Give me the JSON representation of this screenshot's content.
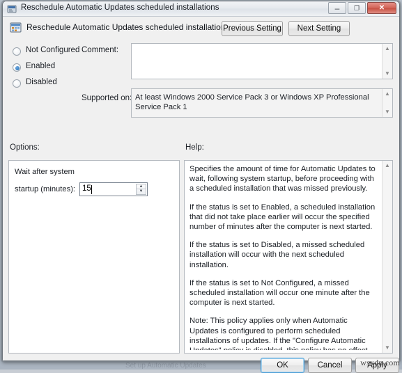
{
  "window": {
    "title": "Reschedule Automatic Updates scheduled installations",
    "title_icon": "policy-setting-icon",
    "minimize_glyph": "–",
    "maximize_glyph": "❐",
    "close_glyph": "✕"
  },
  "header": {
    "icon": "calendar-setting-icon",
    "title": "Reschedule Automatic Updates scheduled installations",
    "previous_button": "Previous Setting",
    "next_button": "Next Setting"
  },
  "state": {
    "options": [
      {
        "label": "Not Configured",
        "selected": false
      },
      {
        "label": "Enabled",
        "selected": true
      },
      {
        "label": "Disabled",
        "selected": false
      }
    ]
  },
  "comment": {
    "label": "Comment:",
    "value": "",
    "scroll_up": "▲",
    "scroll_down": "▼"
  },
  "supported": {
    "label": "Supported on:",
    "value": "At least Windows 2000 Service Pack 3 or Windows XP Professional Service Pack 1",
    "scroll_up": "▲",
    "scroll_down": "▼"
  },
  "options_panel": {
    "label": "Options:",
    "field_label_line1": "Wait after system",
    "field_label_line2": "startup (minutes):",
    "value": "15",
    "spin_up": "▲",
    "spin_down": "▼"
  },
  "help_panel": {
    "label": "Help:",
    "scroll_up": "▲",
    "scroll_down": "▼",
    "paragraphs": [
      "Specifies the amount of time for Automatic Updates to wait, following system startup, before proceeding with a scheduled installation that was missed previously.",
      "If the status is set to Enabled, a scheduled installation that did not take place earlier will occur the specified number of minutes after the computer is next started.",
      "If the status is set to Disabled, a missed scheduled installation will occur with the next scheduled installation.",
      "If the status is set to Not Configured, a missed scheduled installation will occur one minute after the computer is next started.",
      "Note: This policy applies only when Automatic Updates is configured to perform scheduled installations of updates. If the \"Configure Automatic Updates\" policy is disabled, this policy has no effect."
    ]
  },
  "footer": {
    "ok": "OK",
    "cancel": "Cancel",
    "apply": "Apply"
  },
  "watermark": "wsxdn.com",
  "backdrop": {
    "row_text": "Set up Automatic Updates"
  },
  "colors": {
    "accent": "#1f6fb5",
    "close_red": "#c75244",
    "default_button_border": "#4c9ed6"
  }
}
